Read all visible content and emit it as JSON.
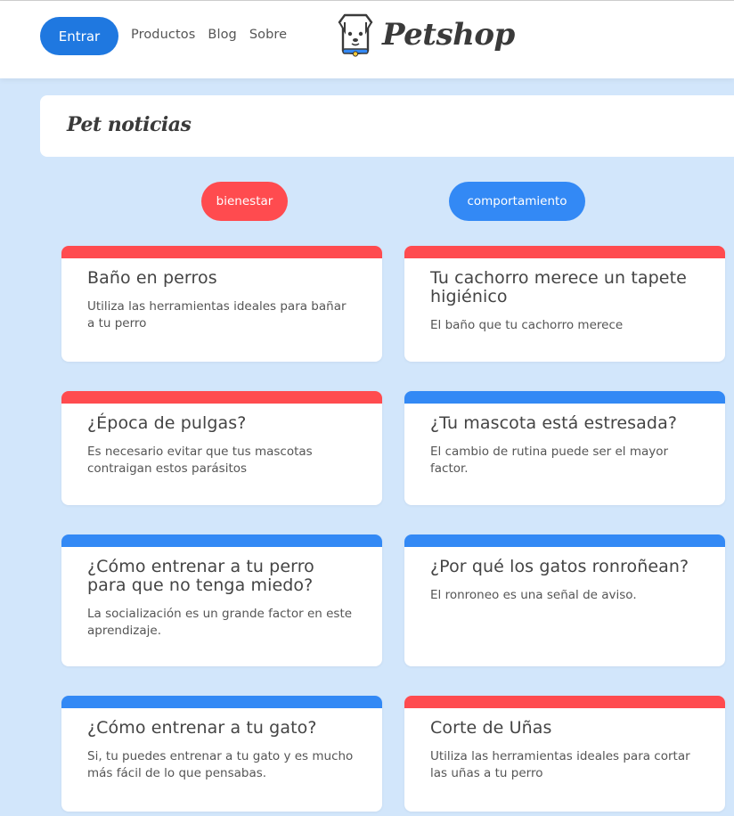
{
  "header": {
    "login_label": "Entrar",
    "nav": [
      "Productos",
      "Blog",
      "Sobre"
    ],
    "logo_text": "Petshop"
  },
  "section": {
    "title": "Pet noticias"
  },
  "filters": [
    {
      "label": "bienestar",
      "color": "#ff4b4f"
    },
    {
      "label": "comportamiento",
      "color": "#3389f5"
    }
  ],
  "colors": {
    "red": "#ff4b4f",
    "blue": "#3389f5",
    "background": "#d2e6fb",
    "login": "#1f78e0"
  },
  "cards": [
    {
      "title": "Baño en perros",
      "desc": "Utiliza las herramientas ideales para bañar a tu perro",
      "category": "bienestar"
    },
    {
      "title": "Tu cachorro merece un tapete higiénico",
      "desc": "El baño que tu cachorro merece",
      "category": "bienestar"
    },
    {
      "title": "¿Época de pulgas?",
      "desc": "Es necesario evitar que tus mascotas contraigan estos parásitos",
      "category": "bienestar"
    },
    {
      "title": "¿Tu mascota está estresada?",
      "desc": "El cambio de rutina puede ser el mayor factor.",
      "category": "comportamiento"
    },
    {
      "title": "¿Cómo entrenar a tu perro para que no tenga miedo?",
      "desc": "La socialización es un grande factor en este aprendizaje.",
      "category": "comportamiento"
    },
    {
      "title": "¿Por qué los gatos ronroñean?",
      "desc": "El ronroneo es una señal de aviso.",
      "category": "comportamiento"
    },
    {
      "title": "¿Cómo entrenar a tu gato?",
      "desc": "Si, tu puedes entrenar a tu gato y es mucho más fácil de lo que pensabas.",
      "category": "comportamiento"
    },
    {
      "title": "Corte de Uñas",
      "desc": "Utiliza las herramientas ideales para cortar las uñas a tu perro",
      "category": "bienestar"
    }
  ]
}
